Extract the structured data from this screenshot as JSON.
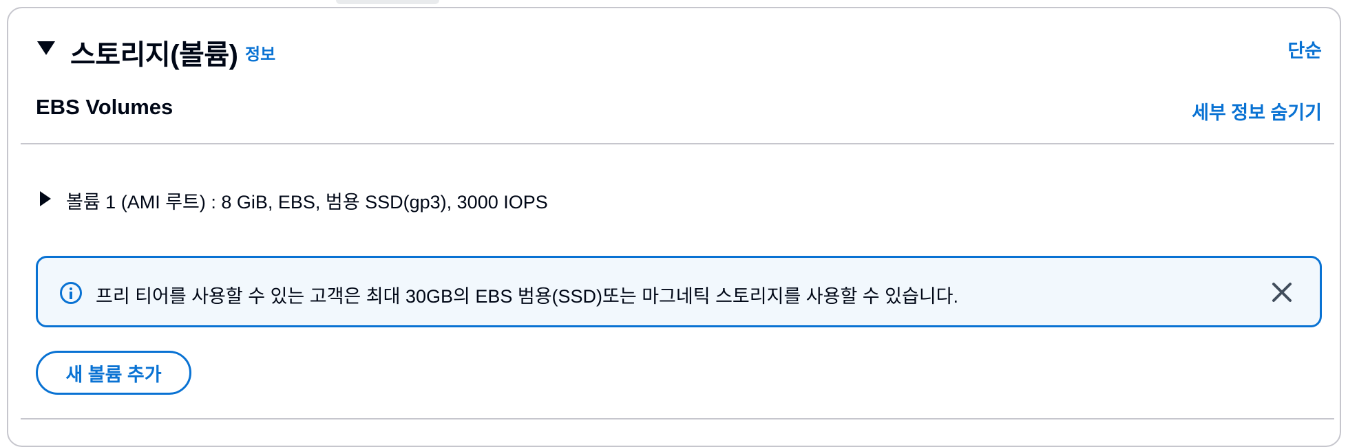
{
  "header": {
    "title": "스토리지(볼륨)",
    "info_link": "정보",
    "simple_link": "단순"
  },
  "ebs": {
    "title": "EBS Volumes",
    "hide_details": "세부 정보 숨기기"
  },
  "volume": {
    "summary": "볼륨 1 (AMI 루트) : 8 GiB, EBS, 범용 SSD(gp3), 3000 IOPS"
  },
  "alert": {
    "message": "프리 티어를 사용할 수 있는 고객은 최대 30GB의 EBS 범용(SSD)또는 마그네틱 스토리지를 사용할 수 있습니다."
  },
  "actions": {
    "add_volume": "새 볼륨 추가"
  },
  "icons": {
    "collapse": "caret-down-icon",
    "expand": "caret-right-icon",
    "info": "info-icon",
    "dismiss": "close-icon"
  },
  "colors": {
    "accent": "#0972d3",
    "alert_bg": "#f2f8fd",
    "text": "#000716",
    "border": "#c6c6cd"
  }
}
